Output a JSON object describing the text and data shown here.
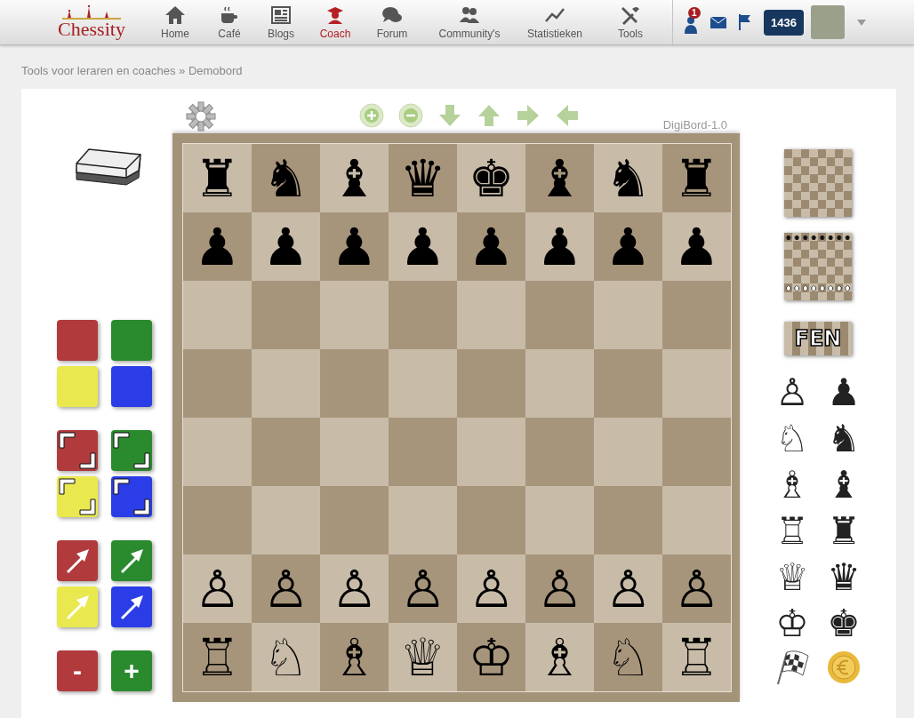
{
  "logo": {
    "name": "Chessity"
  },
  "nav": [
    {
      "label": "Home",
      "selected": false
    },
    {
      "label": "Café",
      "selected": false
    },
    {
      "label": "Blogs",
      "selected": false
    },
    {
      "label": "Coach",
      "selected": true
    },
    {
      "label": "Forum",
      "selected": false
    },
    {
      "label": "Community's",
      "selected": false
    },
    {
      "label": "Statistieken",
      "selected": false
    },
    {
      "label": "Tools",
      "selected": false
    }
  ],
  "user": {
    "notifications": "1",
    "rating": "1436"
  },
  "breadcrumb": "Tools voor leraren en coaches » Demobord",
  "version": "DigiBord-1.0",
  "board": {
    "top_ranks": [
      [
        "♜",
        "♞",
        "♝",
        "♛",
        "♚",
        "♝",
        "♞",
        "♜"
      ],
      [
        "♟",
        "♟",
        "♟",
        "♟",
        "♟",
        "♟",
        "♟",
        "♟"
      ]
    ],
    "bottom_ranks": [
      [
        "♙",
        "♙",
        "♙",
        "♙",
        "♙",
        "♙",
        "♙",
        "♙"
      ],
      [
        "♖",
        "♘",
        "♗",
        "♕",
        "♔",
        "♗",
        "♘",
        "♖"
      ]
    ]
  },
  "markers": [
    {
      "kind": "square",
      "color": "#b03a3c"
    },
    {
      "kind": "square",
      "color": "#2a8a2e"
    },
    {
      "kind": "square",
      "color": "#e9e84e"
    },
    {
      "kind": "square",
      "color": "#2a3de6"
    },
    {
      "kind": "corners",
      "color": "#b03a3c"
    },
    {
      "kind": "corners",
      "color": "#2a8a2e"
    },
    {
      "kind": "corners",
      "color": "#e9e84e"
    },
    {
      "kind": "corners",
      "color": "#2a3de6"
    },
    {
      "kind": "arrow",
      "color": "#b03a3c"
    },
    {
      "kind": "arrow",
      "color": "#2a8a2e"
    },
    {
      "kind": "arrow",
      "color": "#e9e84e"
    },
    {
      "kind": "arrow",
      "color": "#2a3de6"
    },
    {
      "kind": "label",
      "label": "-",
      "color": "#b03a3c"
    },
    {
      "kind": "label",
      "label": "+",
      "color": "#2a8a2e"
    }
  ],
  "setup": [
    {
      "kind": "empty"
    },
    {
      "kind": "start"
    },
    {
      "kind": "fen",
      "label": "FEN"
    }
  ],
  "palette": [
    {
      "glyph": "♙"
    },
    {
      "glyph": "♟"
    },
    {
      "glyph": "♘"
    },
    {
      "glyph": "♞"
    },
    {
      "glyph": "♗"
    },
    {
      "glyph": "♝"
    },
    {
      "glyph": "♖"
    },
    {
      "glyph": "♜"
    },
    {
      "glyph": "♕"
    },
    {
      "glyph": "♛"
    },
    {
      "glyph": "♔"
    },
    {
      "glyph": "♚"
    }
  ]
}
